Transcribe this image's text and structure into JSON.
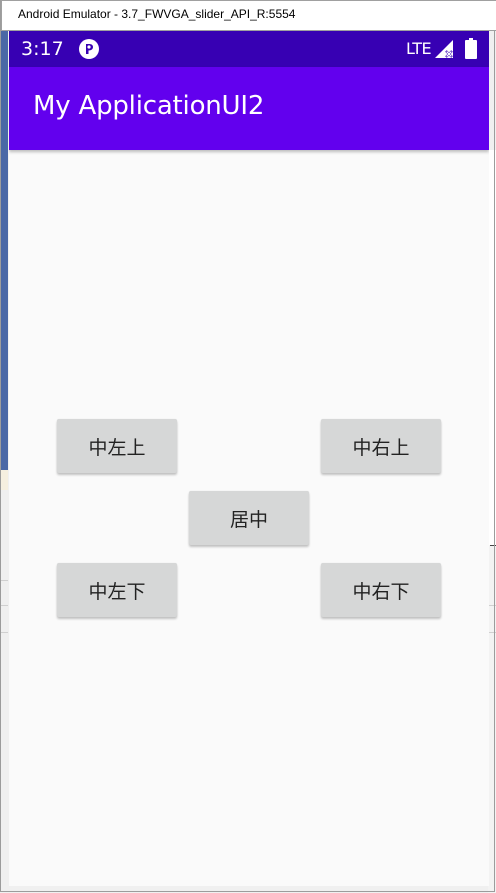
{
  "window": {
    "title": "Android Emulator - 3.7_FWVGA_slider_API_R:5554"
  },
  "status_bar": {
    "time": "3:17",
    "network": "LTE",
    "app_icon": "notification-app-icon",
    "signal_icon": "signal-no-service-icon",
    "battery_icon": "battery-full-icon",
    "color": "#3700b3"
  },
  "app_bar": {
    "title": "My ApplicationUI2",
    "color": "#6200ee"
  },
  "buttons": {
    "middle_left_top": "中左上",
    "middle_right_top": "中右上",
    "center": "居中",
    "middle_left_bottom": "中左下",
    "middle_right_bottom": "中右下"
  }
}
